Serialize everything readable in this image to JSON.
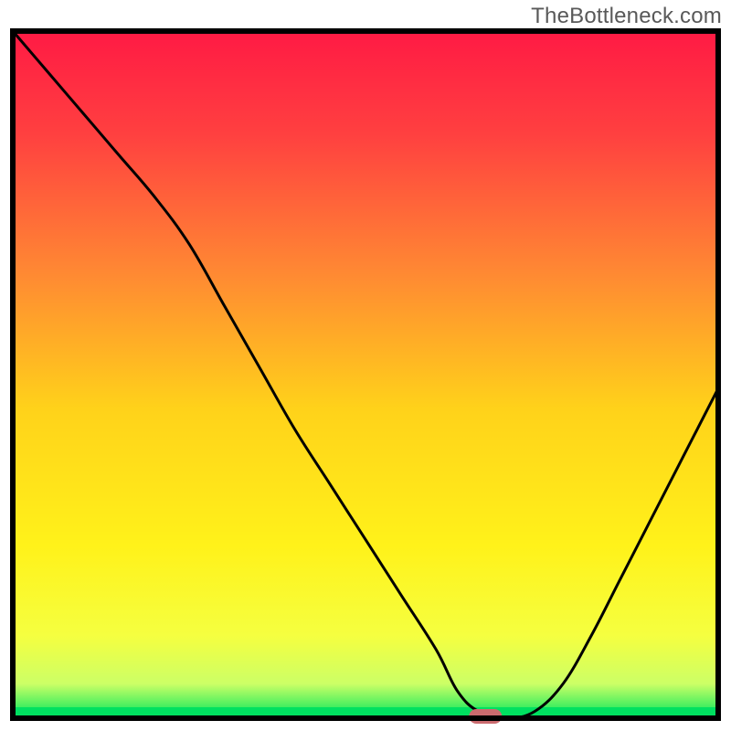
{
  "watermark": "TheBottleneck.com",
  "chart_data": {
    "type": "line",
    "title": "",
    "xlabel": "",
    "ylabel": "",
    "xlim": [
      0,
      100
    ],
    "ylim": [
      0,
      100
    ],
    "x": [
      0,
      5,
      10,
      15,
      20,
      25,
      30,
      35,
      40,
      45,
      50,
      55,
      60,
      63,
      66,
      70,
      74,
      78,
      82,
      86,
      90,
      95,
      100
    ],
    "values": [
      100,
      94,
      88,
      82,
      76,
      69,
      60,
      51,
      42,
      34,
      26,
      18,
      10,
      4,
      1,
      0,
      1,
      5,
      12,
      20,
      28,
      38,
      48
    ],
    "marker": {
      "x": 67,
      "y": 0,
      "color": "#cb6b6f"
    },
    "gradient_stops": [
      {
        "offset": 0.0,
        "color": "#ff1a44"
      },
      {
        "offset": 0.15,
        "color": "#ff4040"
      },
      {
        "offset": 0.35,
        "color": "#ff8833"
      },
      {
        "offset": 0.55,
        "color": "#ffd21a"
      },
      {
        "offset": 0.75,
        "color": "#fff21a"
      },
      {
        "offset": 0.88,
        "color": "#f5ff40"
      },
      {
        "offset": 0.95,
        "color": "#ccff66"
      },
      {
        "offset": 1.0,
        "color": "#00e65c"
      }
    ]
  }
}
